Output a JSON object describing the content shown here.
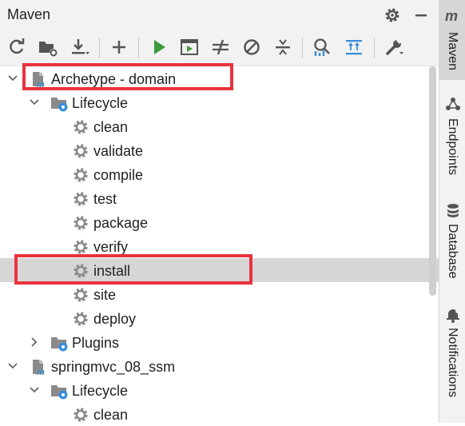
{
  "panel": {
    "title": "Maven"
  },
  "tree": {
    "project1": {
      "name": "Archetype - domain",
      "lifecycle_label": "Lifecycle",
      "goals": [
        "clean",
        "validate",
        "compile",
        "test",
        "package",
        "verify",
        "install",
        "site",
        "deploy"
      ],
      "plugins_label": "Plugins"
    },
    "project2": {
      "name": "springmvc_08_ssm",
      "lifecycle_label": "Lifecycle",
      "goals": [
        "clean"
      ]
    },
    "selected_goal": "install"
  },
  "right_sidebar": {
    "tabs": [
      {
        "label": "Maven",
        "icon": "maven-m-icon",
        "active": true
      },
      {
        "label": "Endpoints",
        "icon": "endpoints-icon",
        "active": false
      },
      {
        "label": "Database",
        "icon": "database-icon",
        "active": false
      },
      {
        "label": "Notifications",
        "icon": "bell-icon",
        "active": false
      }
    ]
  },
  "colors": {
    "highlight": "#e8333c",
    "run_green": "#3d9a3a",
    "accent_blue": "#3b8fd6",
    "selection": "#d6d6d6"
  }
}
